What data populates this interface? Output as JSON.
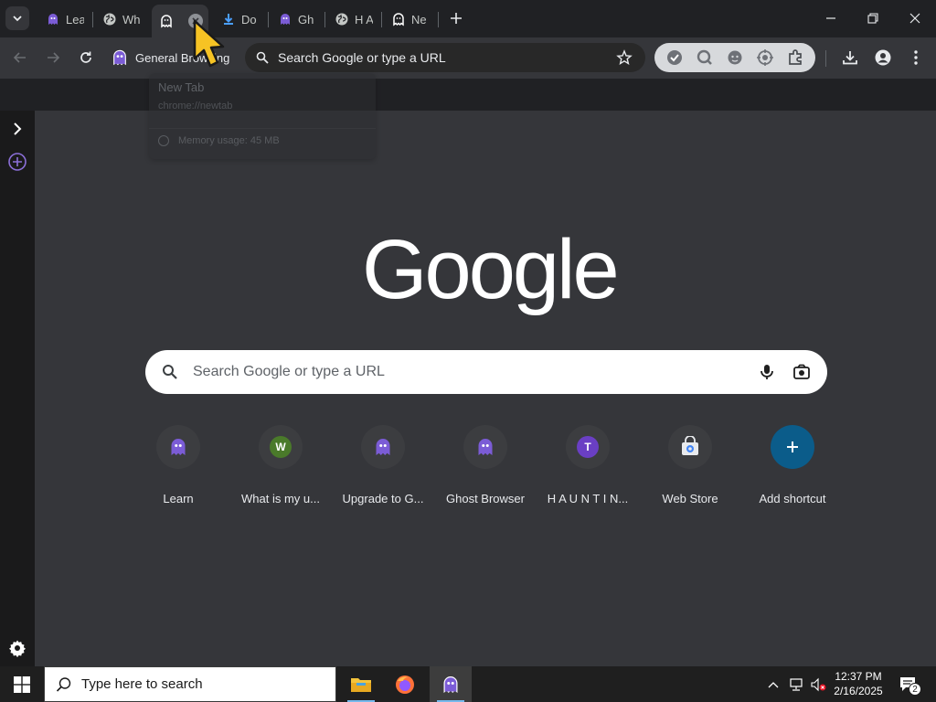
{
  "tabs": [
    {
      "title": "Lea",
      "icon": "ghost-purple-icon"
    },
    {
      "title": "Wh",
      "icon": "globe-icon"
    },
    {
      "title": "",
      "icon": "ghost-white-icon",
      "active": true
    },
    {
      "title": "Do",
      "icon": "download-icon"
    },
    {
      "title": "Gh",
      "icon": "ghost-purple-icon"
    },
    {
      "title": "H A",
      "icon": "globe-icon"
    },
    {
      "title": "Ne",
      "icon": "ghost-white-icon"
    }
  ],
  "hover_card": {
    "title": "New Tab",
    "url": "chrome://newtab",
    "memory": "Memory usage: 45 MB"
  },
  "toolbar": {
    "profile_label": "General Browsing",
    "omnibox_text": "Search Google or type a URL"
  },
  "main": {
    "logo": "Google",
    "search_placeholder": "Search Google or type a URL",
    "shortcuts": [
      {
        "label": "Learn",
        "icon": "ghost-purple-icon"
      },
      {
        "label": "What is my u...",
        "letter": "W",
        "color": "#4a7a2a"
      },
      {
        "label": "Upgrade to G...",
        "icon": "ghost-purple-icon"
      },
      {
        "label": "Ghost Browser",
        "icon": "ghost-purple-icon"
      },
      {
        "label": "H A U N T I N...",
        "letter": "T",
        "color": "#6a3fc4"
      },
      {
        "label": "Web Store",
        "icon": "web-store-icon"
      },
      {
        "label": "Add shortcut",
        "icon": "plus-icon"
      }
    ]
  },
  "taskbar": {
    "search_placeholder": "Type here to search",
    "time": "12:37 PM",
    "date": "2/16/2025",
    "notifications": "2"
  },
  "colors": {
    "accent_purple": "#8b6fd8",
    "download_blue": "#4a9fff",
    "add_shortcut_blue": "#0b5c8a"
  }
}
